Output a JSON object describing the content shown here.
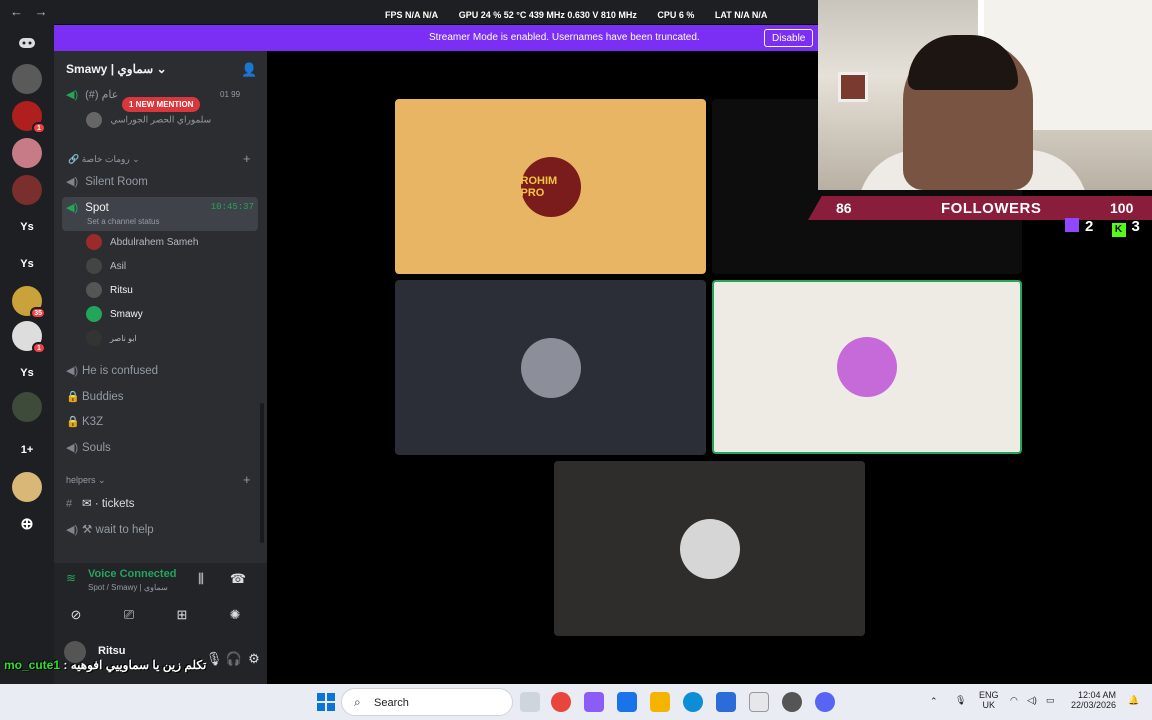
{
  "topbar": {
    "back": "←",
    "forward": "→",
    "stats": [
      "FPS N/A N/A",
      "GPU 24 % 52 °C 439 MHz 0.630 V 810 MHz",
      "CPU 6 %",
      "LAT N/A N/A"
    ]
  },
  "banner": {
    "text": "Streamer Mode is enabled. Usernames have been truncated.",
    "button": "Disable"
  },
  "rail": {
    "items": [
      {
        "label": "",
        "badge": ""
      },
      {
        "label": "",
        "badge": "1"
      },
      {
        "label": "",
        "badge": ""
      },
      {
        "label": "",
        "badge": ""
      },
      {
        "label": "",
        "badge": ""
      },
      {
        "label": "Ys",
        "badge": ""
      },
      {
        "label": "Ys",
        "badge": ""
      },
      {
        "label": "",
        "badge": "35"
      },
      {
        "label": "",
        "badge": "1"
      },
      {
        "label": "Ys",
        "badge": ""
      },
      {
        "label": "",
        "badge": ""
      },
      {
        "label": "1+",
        "badge": ""
      },
      {
        "label": "",
        "badge": ""
      }
    ]
  },
  "sidebar": {
    "server_name": "Smawy | سماوي",
    "general_channel": "(#) عام",
    "mention_pill": "1 NEW MENTION",
    "general_counts": "01  99",
    "general_user": "سلموراي الحصر الجوراسي",
    "category_private": "رومات خاصة",
    "channels": [
      {
        "name": "Silent Room"
      },
      {
        "name": "Spot",
        "status": "Set a channel status",
        "timer": "10:45:37"
      }
    ],
    "voice_users": [
      "Abdulrahem Sameh",
      "Asil",
      "Ritsu",
      "Smawy",
      "ابو ناصر"
    ],
    "more_channels": [
      "He is confused",
      "Buddies",
      "K3Z",
      "Souls"
    ],
    "category_helpers": "helpers",
    "helper_channels": [
      "tickets",
      "wait to help"
    ]
  },
  "voice": {
    "title": "Voice Connected",
    "subtitle": "Spot / Smawy | سماوي"
  },
  "user_panel": {
    "name": "Ritsu"
  },
  "chat_overlay": {
    "user": "mo_cute1",
    "message": " : تكلم زين يا سماوييي افوهيه"
  },
  "stage": {
    "tiles": [
      {
        "label": "ROHIM PRO",
        "color": "#e8b565",
        "speaking": false
      },
      {
        "label": "",
        "color": "#0d0d0d",
        "speaking": false
      },
      {
        "label": "",
        "color": "#2b2d37",
        "speaking": false
      },
      {
        "label": "",
        "color": "#eeeae4",
        "speaking": true
      },
      {
        "label": "",
        "color": "#2e2d2b",
        "speaking": false
      }
    ]
  },
  "overlay": {
    "followers_current": "86",
    "followers_label": "FOLLOWERS",
    "followers_goal": "100",
    "twitch_count": "2",
    "kick_count": "3"
  },
  "taskbar": {
    "search": "Search",
    "lang_top": "ENG",
    "lang_bottom": "UK",
    "time": "12:04 AM",
    "date": "22/03/2026"
  },
  "colors": {
    "blurple": "#7b2ff5",
    "green": "#23a55a",
    "red": "#f23f43"
  }
}
